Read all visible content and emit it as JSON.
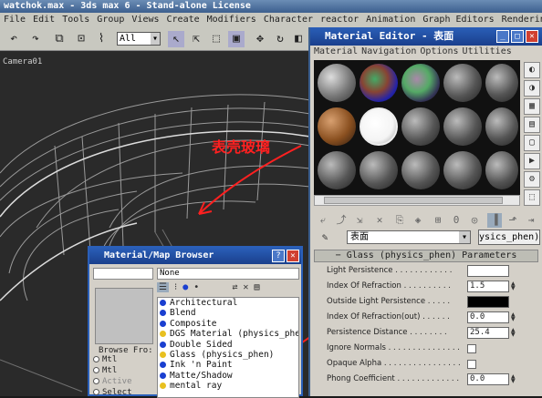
{
  "app": {
    "title": "watchok.max - 3ds max 6 - Stand-alone License"
  },
  "menubar": [
    "File",
    "Edit",
    "Tools",
    "Group",
    "Views",
    "Create",
    "Modifiers",
    "Character",
    "reactor",
    "Animation",
    "Graph Editors",
    "Rendering"
  ],
  "toolbar": {
    "selection_filter": "All"
  },
  "viewport": {
    "label": "Camera01",
    "annotation": "表壳玻璃"
  },
  "material_editor": {
    "title": "Material Editor - 表面",
    "menu": [
      "Material",
      "Navigation",
      "Options",
      "Utilities"
    ],
    "material_name": "表面",
    "material_type": "ysics_phen)",
    "rollout_title": "Glass (physics_phen) Parameters",
    "params": [
      {
        "label": "Light Persistence",
        "kind": "color",
        "value": "",
        "color": "#ffffff"
      },
      {
        "label": "Index Of Refraction",
        "kind": "number",
        "value": "1.5"
      },
      {
        "label": "Outside Light Persistence",
        "kind": "color",
        "value": "",
        "color": "#000000"
      },
      {
        "label": "Index Of Refraction(out)",
        "kind": "number",
        "value": "0.0"
      },
      {
        "label": "Persistence Distance",
        "kind": "number",
        "value": "25.4"
      },
      {
        "label": "Ignore Normals",
        "kind": "check",
        "value": ""
      },
      {
        "label": "Opaque Alpha",
        "kind": "check",
        "value": ""
      },
      {
        "label": "Phong Coefficient",
        "kind": "number",
        "value": "0.0"
      }
    ]
  },
  "material_browser": {
    "title": "Material/Map Browser",
    "current": "None",
    "browse_from_label": "Browse Fro:",
    "browse_from": [
      "Mtl",
      "Mtl",
      "Active",
      "Select"
    ],
    "items": [
      {
        "label": "Architectural",
        "dot": "blue"
      },
      {
        "label": "Blend",
        "dot": "blue"
      },
      {
        "label": "Composite",
        "dot": "blue"
      },
      {
        "label": "DGS Material (physics_phe",
        "dot": "yellow"
      },
      {
        "label": "Double Sided",
        "dot": "blue"
      },
      {
        "label": "Glass (physics_phen)",
        "dot": "yellow"
      },
      {
        "label": "Ink 'n Paint",
        "dot": "blue"
      },
      {
        "label": "Matte/Shadow",
        "dot": "blue"
      },
      {
        "label": "mental ray",
        "dot": "yellow"
      }
    ]
  },
  "colors": {
    "annotation": "#ff2020",
    "title_blue": "#2a5fb8"
  }
}
